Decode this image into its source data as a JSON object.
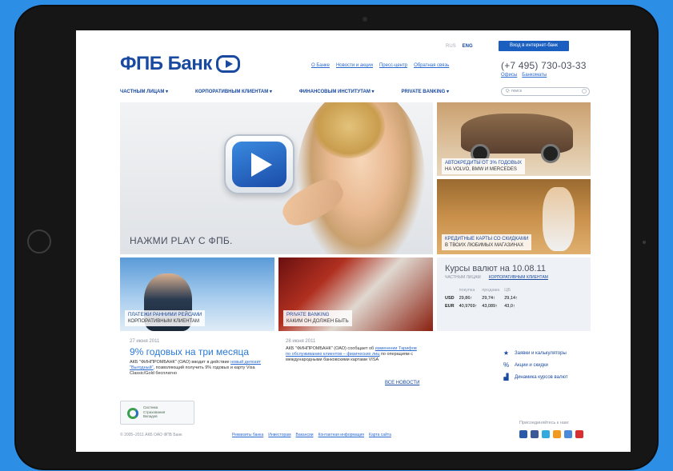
{
  "header": {
    "logo_text": "ФПБ Банк",
    "lang_ru": "RUS",
    "lang_en": "ENG",
    "login_button": "Вход в интернет-банк",
    "top_links": [
      "О Банке",
      "Новости и акции",
      "Пресс-центр",
      "Обратная связь"
    ],
    "phone": "(+7 495) 730-03-33",
    "phone_links": [
      "Офисы",
      "Банкоматы"
    ],
    "search_placeholder": "Q- поиск"
  },
  "nav": [
    "ЧАСТНЫМ ЛИЦАМ ▾",
    "КОРПОРАТИВНЫМ КЛИЕНТАМ ▾",
    "ФИНАНСОВЫМ ИНСТИТУТАМ ▾",
    "PRIVATE BANKING ▾"
  ],
  "hero": {
    "caption": "НАЖМИ PLAY С ФПБ."
  },
  "promos": [
    {
      "line1": "АВТОКРЕДИТЫ ОТ 3% ГОДОВЫХ",
      "line2": "НА VOLVO, BMW И MERCEDES"
    },
    {
      "line1": "КРЕДИТНЫЕ КАРТЫ СО СКИДКАМИ",
      "line2": "В ТВОИХ ЛЮБИМЫХ МАГАЗИНАХ"
    }
  ],
  "tiles": [
    {
      "line1": "ПЛАТЕЖИ РАННИМИ РЕЙСАМИ",
      "line2": "КОРПОРАТИВНЫМ КЛИЕНТАМ"
    },
    {
      "line1": "PRIVATE BANKING",
      "line2": "КАКИМ ОН ДОЛЖЕН БЫТЬ"
    }
  ],
  "rates": {
    "title": "Курсы валют на 10.08.11",
    "tab_private": "ЧАСТНЫМ ЛИЦАМ",
    "tab_corporate": "КОРПОРАТИВНЫМ КЛИЕНТАМ",
    "headers": [
      "",
      "покупка",
      "продажа",
      "ЦБ"
    ],
    "rows": [
      {
        "cur": "USD",
        "buy": "29,86↑",
        "sell": "29,74↑",
        "cb": "29,14↑"
      },
      {
        "cur": "EUR",
        "buy": "40,9769↑",
        "sell": "43,089↑",
        "cb": "43,0↑"
      }
    ]
  },
  "news": [
    {
      "date": "27 июня 2011",
      "headline": "9% годовых на три месяца",
      "body_pre": "АКБ \"ФИНПРОМБАНК\" (ОАО) вводит в действие ",
      "body_link": "новый депозит \"Выгодный\"",
      "body_post": ", позволяющий получить 9% годовых и карту Visa Classic/Gold бесплатно"
    },
    {
      "date": "28 июня 2011",
      "body_pre": "АКБ \"ФИНПРОМБАНК\" (ОАО) сообщает об ",
      "body_link": "изменении Тарифов по обслуживанию клиентов – физических лиц",
      "body_post": " по операциям с международными банковскими картами VISA"
    }
  ],
  "all_news": "ВСЕ НОВОСТИ",
  "side_links": [
    "Заявки и калькуляторы",
    "Акции и скидки",
    "Динамика курсов валют"
  ],
  "insurance": [
    "Система",
    "Страхования",
    "Вкладов"
  ],
  "footer": {
    "copyright": "© 2005–2011 АКБ ОАО ФПБ Банк",
    "links": [
      "Реквизиты банка",
      "Инвесторам",
      "Вакансии",
      "Контактная информация",
      "Карта сайта"
    ],
    "join": "Присоединяйтесь к нам:"
  },
  "colors": {
    "page_bg": "#2d8ee6",
    "brand": "#1a4aa0",
    "link": "#2a6ad0"
  }
}
